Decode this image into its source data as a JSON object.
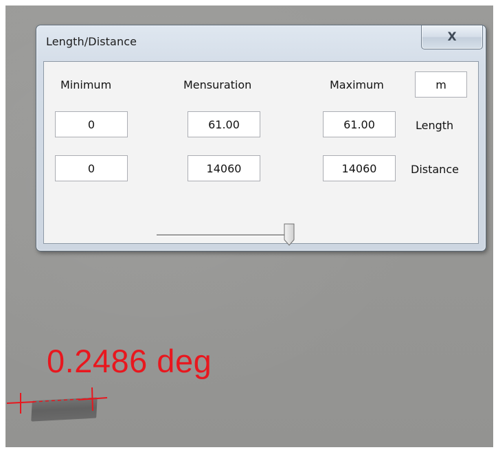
{
  "window": {
    "title": "Length/Distance",
    "close_glyph": "X"
  },
  "headers": {
    "minimum": "Minimum",
    "mensuration": "Mensuration",
    "maximum": "Maximum",
    "unit": "m"
  },
  "rows": [
    {
      "label": "Length",
      "minimum": "0",
      "mensuration": "61.00",
      "maximum": "61.00"
    },
    {
      "label": "Distance",
      "minimum": "0",
      "mensuration": "14060",
      "maximum": "14060"
    }
  ],
  "slider": {
    "value_fraction": 1.0
  },
  "overlay": {
    "measurement": "0.2486 deg",
    "color": "#e8171e"
  },
  "icons": {
    "close": "close-icon",
    "slider_thumb": "slider-thumb-icon",
    "crosshair": "crosshair-marker-icon"
  }
}
